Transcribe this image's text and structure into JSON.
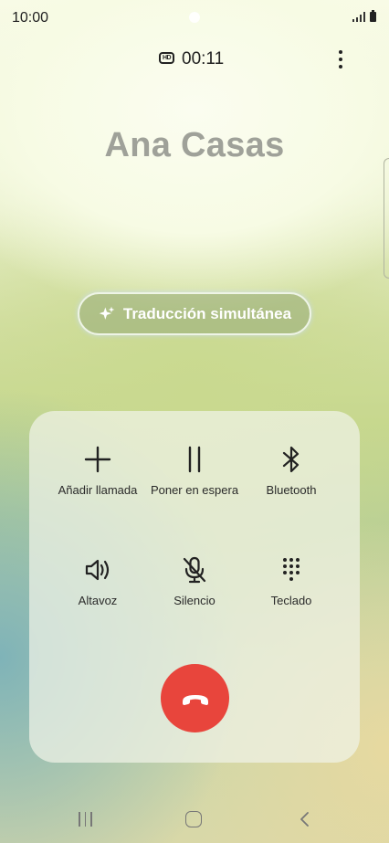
{
  "status_bar": {
    "time": "10:00"
  },
  "call": {
    "hd_label": "HD",
    "duration": "00:11",
    "caller_name": "Ana Casas",
    "translate_label": "Traducción simultánea"
  },
  "controls": [
    {
      "label": "Añadir llamada",
      "icon": "add-call-icon"
    },
    {
      "label": "Poner en espera",
      "icon": "pause-icon"
    },
    {
      "label": "Bluetooth",
      "icon": "bluetooth-icon"
    },
    {
      "label": "Altavoz",
      "icon": "speaker-icon"
    },
    {
      "label": "Silencio",
      "icon": "mute-mic-icon"
    },
    {
      "label": "Teclado",
      "icon": "keypad-icon"
    }
  ],
  "end_call": {
    "icon": "end-call-icon",
    "color": "#e8453c"
  },
  "navigation": {
    "recent": "recent-apps-icon",
    "home": "home-icon",
    "back": "back-icon"
  }
}
